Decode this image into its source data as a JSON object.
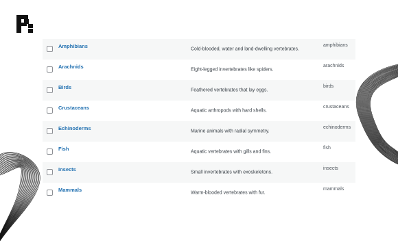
{
  "table": {
    "rows": [
      {
        "name": "Amphibians",
        "description": "Cold-blooded, water and land-dwelling vertebrates.",
        "slug": "amphibians"
      },
      {
        "name": "Arachnids",
        "description": "Eight-legged invertebrates like spiders.",
        "slug": "arachnids"
      },
      {
        "name": "Birds",
        "description": "Feathered vertebrates that lay eggs.",
        "slug": "birds"
      },
      {
        "name": "Crustaceans",
        "description": "Aquatic arthropods with hard shells.",
        "slug": "crustaceans"
      },
      {
        "name": "Echinoderms",
        "description": "Marine animals with radial symmetry.",
        "slug": "echinoderms"
      },
      {
        "name": "Fish",
        "description": "Aquatic vertebrates with gills and fins.",
        "slug": "fish"
      },
      {
        "name": "Insects",
        "description": "Small invertebrates with exoskeletons.",
        "slug": "insects"
      },
      {
        "name": "Mammals",
        "description": "Warm-blooded vertebrates with fur.",
        "slug": "mammals"
      }
    ]
  },
  "colors": {
    "link": "#2271b1",
    "stripe": "#f6f7f7"
  },
  "icons": {
    "logo": "brand-logo-icon"
  }
}
